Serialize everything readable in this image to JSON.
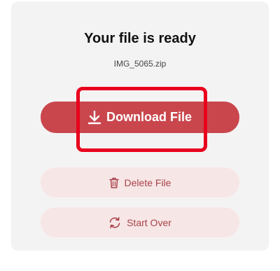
{
  "card": {
    "title": "Your file is ready",
    "filename": "IMG_5065.zip"
  },
  "buttons": {
    "download": {
      "label": "Download File",
      "icon": "download-icon"
    },
    "delete": {
      "label": "Delete File",
      "icon": "trash-icon"
    },
    "start_over": {
      "label": "Start Over",
      "icon": "refresh-icon"
    }
  },
  "colors": {
    "primary": "#c9464d",
    "secondary_bg": "#f7e6e6",
    "secondary_text": "#a8434a",
    "annotation": "#e8001d",
    "card_bg": "#f4f3f3"
  }
}
